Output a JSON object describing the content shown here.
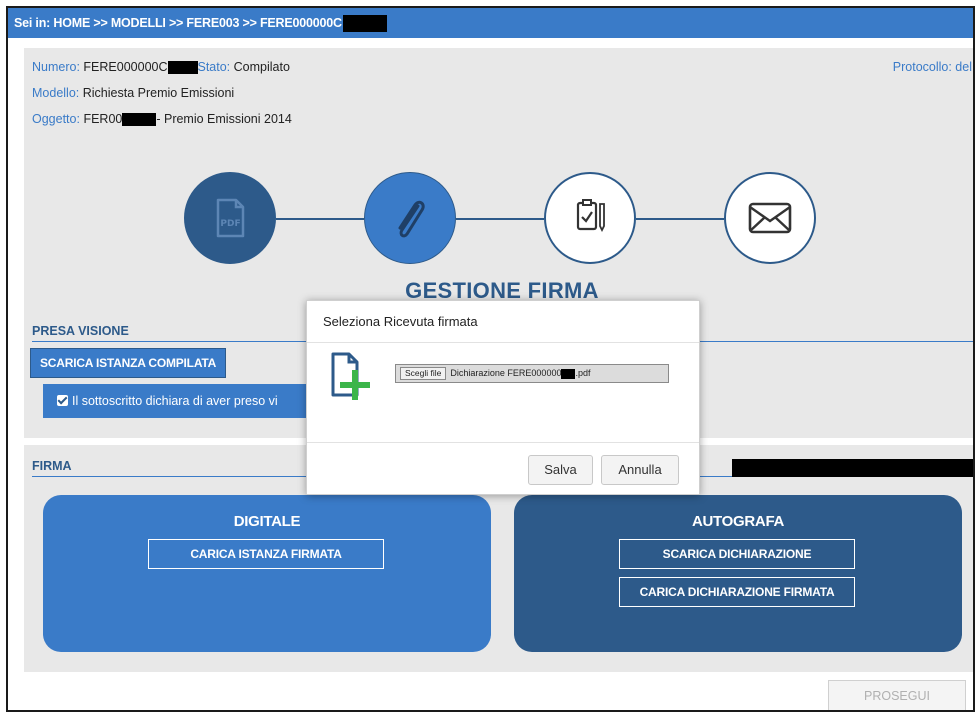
{
  "breadcrumb": {
    "text": "Sei in: HOME >> MODELLI >> FERE003 >> FERE000000C"
  },
  "header": {
    "numero_label": "Numero:",
    "numero_value": "FERE000000C",
    "stato_label": "Stato:",
    "stato_value": "Compilato",
    "protocollo_label": "Protocollo: del",
    "modello_label": "Modello:",
    "modello_value": "Richiesta Premio Emissioni",
    "oggetto_label": "Oggetto:",
    "oggetto_value_prefix": "FER00",
    "oggetto_value_suffix": "- Premio Emissioni 2014"
  },
  "steps": {
    "items": [
      {
        "icon": "pdf-icon",
        "label": "PDF"
      },
      {
        "icon": "paperclip-icon"
      },
      {
        "icon": "clipboard-check-icon"
      },
      {
        "icon": "envelope-icon"
      }
    ],
    "title": "GESTIONE FIRMA"
  },
  "presa_visione": {
    "title": "PRESA VISIONE",
    "download_button": "SCARICA ISTANZA COMPILATA",
    "checkbox_label": "Il sottoscritto dichiara di aver preso vi"
  },
  "firma": {
    "title": "FIRMA",
    "digitale": {
      "title": "DIGITALE",
      "upload_button": "CARICA ISTANZA FIRMATA"
    },
    "autografa": {
      "title": "AUTOGRAFA",
      "download_button": "SCARICA DICHIARAZIONE",
      "upload_button": "CARICA DICHIARAZIONE FIRMATA"
    }
  },
  "footer": {
    "prosegui_button": "PROSEGUI"
  },
  "modal": {
    "title": "Seleziona Ricevuta firmata",
    "file_button": "Scegli file",
    "file_name_prefix": "Dichiarazione FERE000000",
    "file_name_suffix": ".pdf",
    "save_button": "Salva",
    "cancel_button": "Annulla"
  },
  "colors": {
    "brand_blue": "#3a7bc8",
    "dark_blue": "#2d5a8a",
    "panel_gray": "#e8e8e8",
    "file_add_green": "#3bb54a"
  }
}
